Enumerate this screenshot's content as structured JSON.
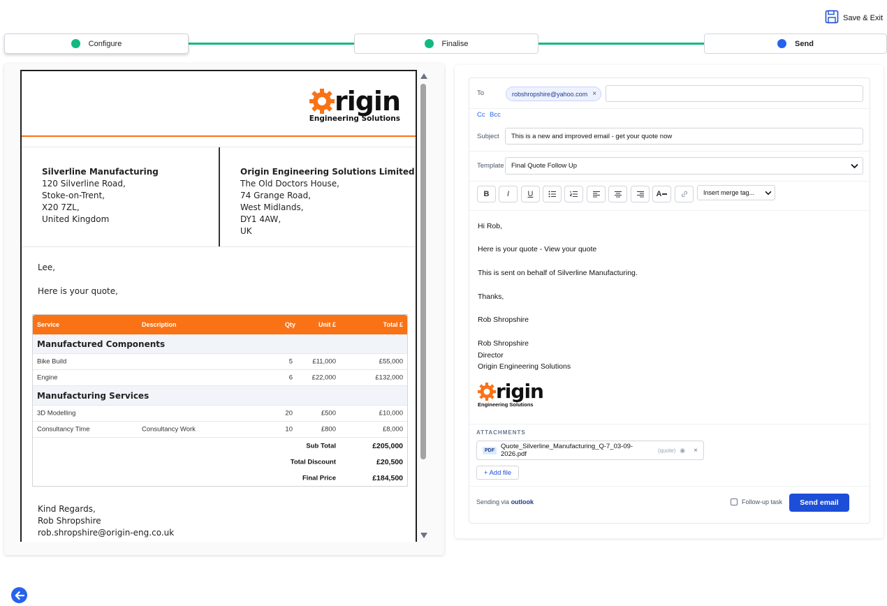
{
  "header": {
    "save_exit_label": "Save & Exit"
  },
  "stepper": {
    "steps": [
      {
        "label": "Configure",
        "dot_color": "#10b981"
      },
      {
        "label": "Finalise",
        "dot_color": "#10b981"
      },
      {
        "label": "Send",
        "dot_color": "#2563eb"
      }
    ],
    "line_color": "#10b981"
  },
  "quote_doc": {
    "logo": {
      "word": "rigin",
      "sub": "Engineering Solutions",
      "gear_color": "#f97316"
    },
    "from": {
      "name": "Silverline Manufacturing",
      "lines": [
        "120 Silverline Road,",
        "Stoke-on-Trent,",
        "X20 7ZL,",
        "United Kingdom"
      ]
    },
    "to": {
      "name": "Origin Engineering Solutions Limited",
      "lines": [
        "The Old Doctors House,",
        "74 Grange Road,",
        "West Midlands,",
        "DY1 4AW,",
        "UK"
      ]
    },
    "greeting": "Lee,",
    "intro": "Here is your quote,",
    "table": {
      "headers": {
        "service": "Service",
        "description": "Description",
        "qty": "Qty",
        "unit": "Unit £",
        "total": "Total £"
      },
      "sections": [
        {
          "title": "Manufactured Components",
          "rows": [
            {
              "service": "Bike Build",
              "description": "",
              "qty": "5",
              "unit": "£11,000",
              "total": "£55,000"
            },
            {
              "service": "Engine",
              "description": "",
              "qty": "6",
              "unit": "£22,000",
              "total": "£132,000"
            }
          ]
        },
        {
          "title": "Manufacturing Services",
          "rows": [
            {
              "service": "3D Modelling",
              "description": "",
              "qty": "20",
              "unit": "£500",
              "total": "£10,000"
            },
            {
              "service": "Consultancy Time",
              "description": "Consultancy Work",
              "qty": "10",
              "unit": "£800",
              "total": "£8,000"
            }
          ]
        }
      ],
      "totals": [
        {
          "label": "Sub Total",
          "value": "£205,000"
        },
        {
          "label": "Total Discount",
          "value": "£20,500"
        },
        {
          "label": "Final Price",
          "value": "£184,500"
        }
      ],
      "header_color": "#f97316"
    },
    "sign_off": [
      "Kind Regards,",
      "Rob Shropshire",
      "rob.shropshire@origin-eng.co.uk"
    ]
  },
  "email": {
    "to_label": "To",
    "to_chip": "robshropshire@yahoo.com",
    "cc_label": "Cc",
    "bcc_label": "Bcc",
    "subject_label": "Subject",
    "subject_value": "This is a new and improved email - get your quote now",
    "template_label": "Template",
    "template_value": "Final Quote Follow Up",
    "merge_tag_label": "Insert merge tag...",
    "body_lines": [
      "Hi Rob,",
      "Here is your quote - View your quote",
      "This is sent on behalf of Silverline Manufacturing.",
      "Thanks,",
      "Rob Shropshire",
      "Rob Shropshire",
      "Director",
      "Origin Engineering Solutions"
    ],
    "attachments_title": "ATTACHMENTS",
    "attachment": {
      "badge": "PDF",
      "name": "Quote_Silverline_Manufacturing_Q-7_03-09-2026.pdf",
      "tag": "(quote)"
    },
    "add_file_label": "+ Add file",
    "sending_via_prefix": "Sending via",
    "sending_via_provider": "outlook",
    "followup_label": "Follow-up task",
    "send_label": "Send email",
    "accent": "#1d4ed8"
  }
}
